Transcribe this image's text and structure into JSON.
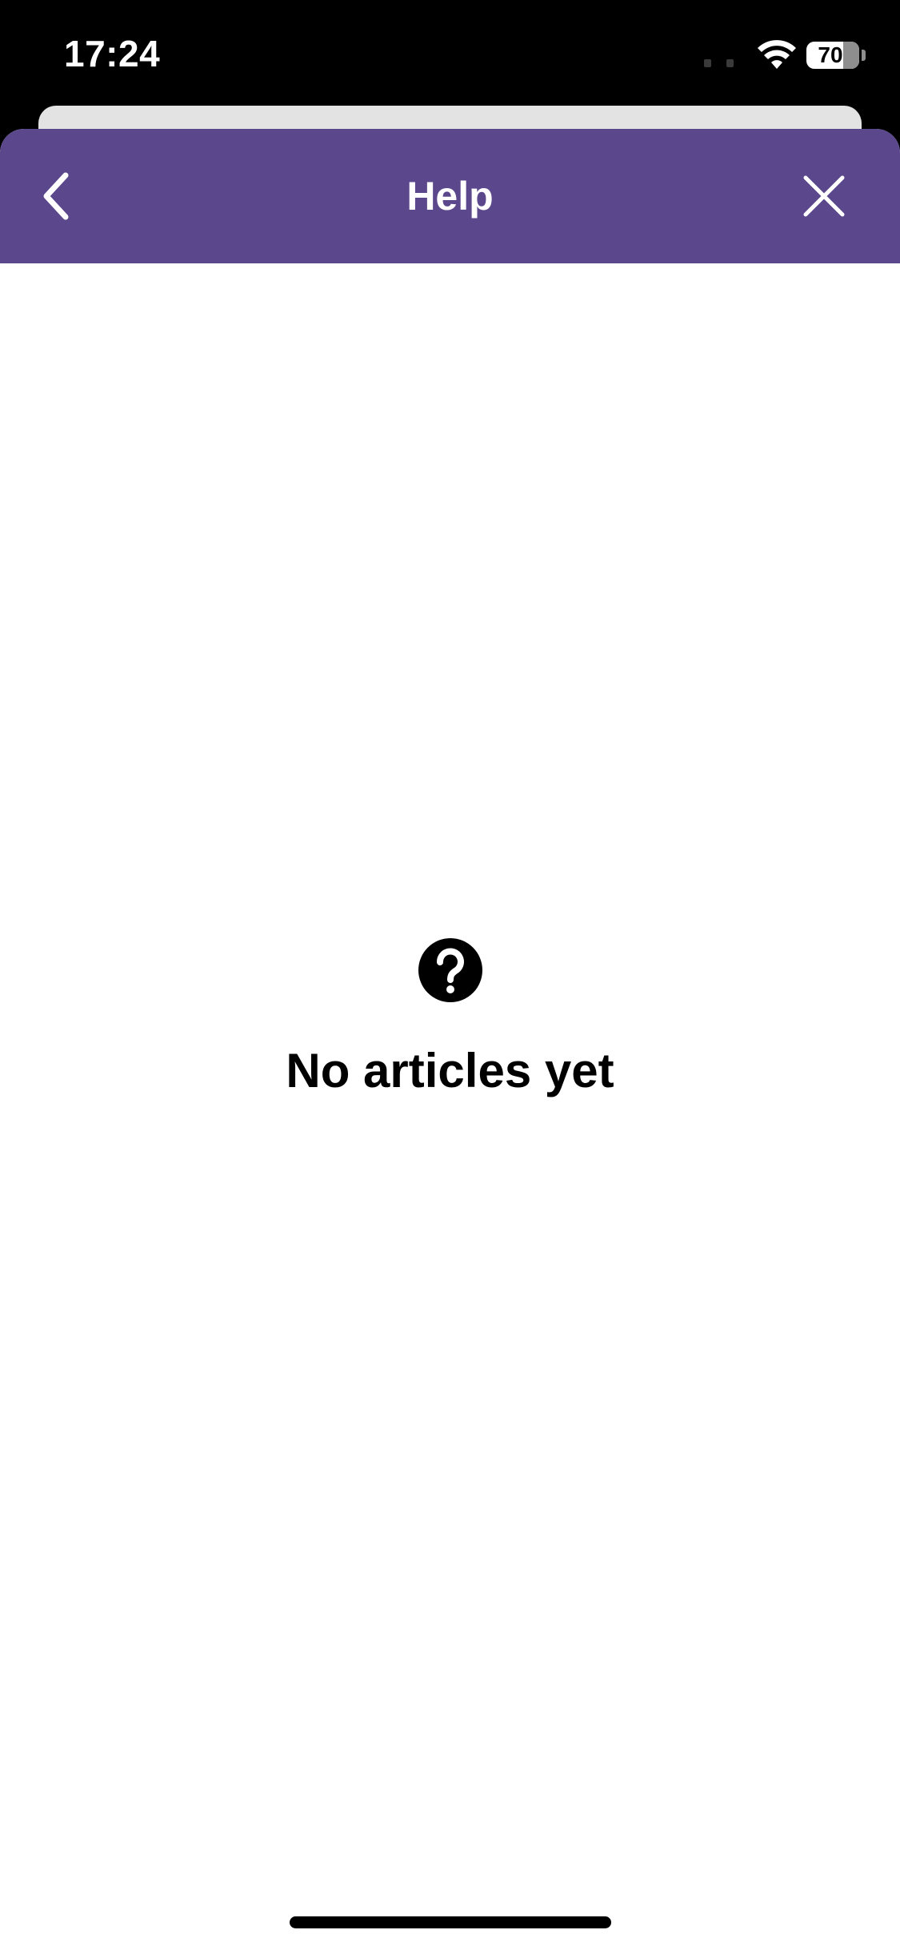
{
  "status_bar": {
    "time": "17:24",
    "battery_level": "70"
  },
  "nav": {
    "title": "Help",
    "back_icon": "chevron-left-icon",
    "close_icon": "close-icon"
  },
  "empty_state": {
    "icon": "question-circle-icon",
    "message": "No articles yet"
  },
  "colors": {
    "header_background": "#5b478c",
    "header_text": "#ffffff",
    "page_background": "#ffffff"
  }
}
